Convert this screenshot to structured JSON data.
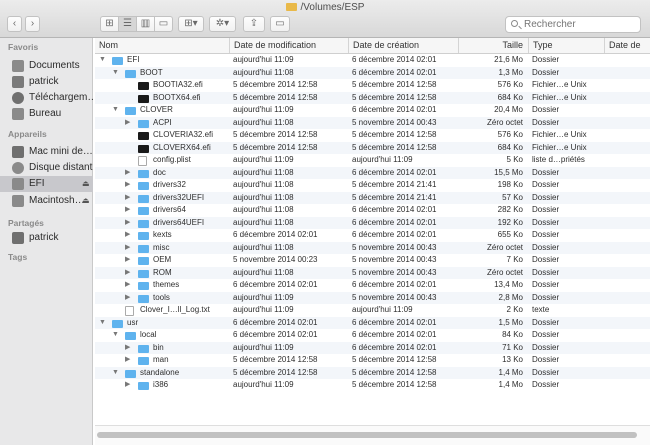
{
  "window": {
    "title": "/Volumes/ESP"
  },
  "toolbar": {
    "back": "‹",
    "forward": "›",
    "views": [
      "⊞",
      "☰",
      "▥",
      "▭"
    ],
    "arrange": "⊞▾",
    "action": "✲▾",
    "share": "⇪",
    "tags": "▭",
    "search_placeholder": "Rechercher"
  },
  "sidebar": {
    "sections": [
      {
        "title": "Favoris",
        "items": [
          {
            "label": "Documents",
            "icon": "documents-icon"
          },
          {
            "label": "patrick",
            "icon": "home-icon"
          },
          {
            "label": "Téléchargem…",
            "icon": "downloads-icon"
          },
          {
            "label": "Bureau",
            "icon": "desktop-icon"
          }
        ]
      },
      {
        "title": "Appareils",
        "items": [
          {
            "label": "Mac mini de…",
            "icon": "computer-icon"
          },
          {
            "label": "Disque distant",
            "icon": "disc-icon"
          },
          {
            "label": "EFI",
            "icon": "drive-icon",
            "eject": "⏏",
            "selected": true
          },
          {
            "label": "Macintosh…",
            "icon": "drive-icon",
            "eject": "⏏"
          }
        ]
      },
      {
        "title": "Partagés",
        "items": [
          {
            "label": "patrick",
            "icon": "network-computer-icon"
          }
        ]
      },
      {
        "title": "Tags",
        "items": []
      }
    ]
  },
  "columns": {
    "name": "Nom",
    "modified": "Date de modification",
    "created": "Date de création",
    "size": "Taille",
    "kind": "Type",
    "added": "Date de"
  },
  "files": [
    {
      "name": "EFI",
      "level": 0,
      "tri": "▼",
      "icon": "folder",
      "modified": "aujourd'hui 11:09",
      "created": "6 décembre 2014 02:01",
      "size": "21,6 Mo",
      "kind": "Dossier"
    },
    {
      "name": "BOOT",
      "level": 1,
      "tri": "▼",
      "icon": "folder",
      "modified": "aujourd'hui 11:08",
      "created": "6 décembre 2014 02:01",
      "size": "1,3 Mo",
      "kind": "Dossier"
    },
    {
      "name": "BOOTIA32.efi",
      "level": 2,
      "tri": "",
      "icon": "exec",
      "modified": "5 décembre 2014 12:58",
      "created": "5 décembre 2014 12:58",
      "size": "576 Ko",
      "kind": "Fichier…e Unix"
    },
    {
      "name": "BOOTX64.efi",
      "level": 2,
      "tri": "",
      "icon": "exec",
      "modified": "5 décembre 2014 12:58",
      "created": "5 décembre 2014 12:58",
      "size": "684 Ko",
      "kind": "Fichier…e Unix"
    },
    {
      "name": "CLOVER",
      "level": 1,
      "tri": "▼",
      "icon": "folder",
      "modified": "aujourd'hui 11:09",
      "created": "6 décembre 2014 02:01",
      "size": "20,4 Mo",
      "kind": "Dossier"
    },
    {
      "name": "ACPI",
      "level": 2,
      "tri": "▶",
      "icon": "folder",
      "modified": "aujourd'hui 11:08",
      "created": "5 novembre 2014 00:43",
      "size": "Zéro octet",
      "kind": "Dossier"
    },
    {
      "name": "CLOVERIA32.efi",
      "level": 2,
      "tri": "",
      "icon": "exec",
      "modified": "5 décembre 2014 12:58",
      "created": "5 décembre 2014 12:58",
      "size": "576 Ko",
      "kind": "Fichier…e Unix"
    },
    {
      "name": "CLOVERX64.efi",
      "level": 2,
      "tri": "",
      "icon": "exec",
      "modified": "5 décembre 2014 12:58",
      "created": "5 décembre 2014 12:58",
      "size": "684 Ko",
      "kind": "Fichier…e Unix"
    },
    {
      "name": "config.plist",
      "level": 2,
      "tri": "",
      "icon": "doc",
      "modified": "aujourd'hui 11:09",
      "created": "aujourd'hui 11:09",
      "size": "5 Ko",
      "kind": "liste d…priétés"
    },
    {
      "name": "doc",
      "level": 2,
      "tri": "▶",
      "icon": "folder",
      "modified": "aujourd'hui 11:08",
      "created": "6 décembre 2014 02:01",
      "size": "15,5 Mo",
      "kind": "Dossier"
    },
    {
      "name": "drivers32",
      "level": 2,
      "tri": "▶",
      "icon": "folder",
      "modified": "aujourd'hui 11:08",
      "created": "5 décembre 2014 21:41",
      "size": "198 Ko",
      "kind": "Dossier"
    },
    {
      "name": "drivers32UEFI",
      "level": 2,
      "tri": "▶",
      "icon": "folder",
      "modified": "aujourd'hui 11:08",
      "created": "5 décembre 2014 21:41",
      "size": "57 Ko",
      "kind": "Dossier"
    },
    {
      "name": "drivers64",
      "level": 2,
      "tri": "▶",
      "icon": "folder",
      "modified": "aujourd'hui 11:08",
      "created": "6 décembre 2014 02:01",
      "size": "282 Ko",
      "kind": "Dossier"
    },
    {
      "name": "drivers64UEFI",
      "level": 2,
      "tri": "▶",
      "icon": "folder",
      "modified": "aujourd'hui 11:08",
      "created": "6 décembre 2014 02:01",
      "size": "192 Ko",
      "kind": "Dossier"
    },
    {
      "name": "kexts",
      "level": 2,
      "tri": "▶",
      "icon": "folder",
      "modified": "6 décembre 2014 02:01",
      "created": "6 décembre 2014 02:01",
      "size": "655 Ko",
      "kind": "Dossier"
    },
    {
      "name": "misc",
      "level": 2,
      "tri": "▶",
      "icon": "folder",
      "modified": "aujourd'hui 11:08",
      "created": "5 novembre 2014 00:43",
      "size": "Zéro octet",
      "kind": "Dossier"
    },
    {
      "name": "OEM",
      "level": 2,
      "tri": "▶",
      "icon": "folder",
      "modified": "5 novembre 2014 00:23",
      "created": "5 novembre 2014 00:43",
      "size": "7 Ko",
      "kind": "Dossier"
    },
    {
      "name": "ROM",
      "level": 2,
      "tri": "▶",
      "icon": "folder",
      "modified": "aujourd'hui 11:08",
      "created": "5 novembre 2014 00:43",
      "size": "Zéro octet",
      "kind": "Dossier"
    },
    {
      "name": "themes",
      "level": 2,
      "tri": "▶",
      "icon": "folder",
      "modified": "6 décembre 2014 02:01",
      "created": "6 décembre 2014 02:01",
      "size": "13,4 Mo",
      "kind": "Dossier"
    },
    {
      "name": "tools",
      "level": 2,
      "tri": "▶",
      "icon": "folder",
      "modified": "aujourd'hui 11:09",
      "created": "5 novembre 2014 00:43",
      "size": "2,8 Mo",
      "kind": "Dossier"
    },
    {
      "name": "Clover_I…ll_Log.txt",
      "level": 1,
      "tri": "",
      "icon": "doc",
      "modified": "aujourd'hui 11:09",
      "created": "aujourd'hui 11:09",
      "size": "2 Ko",
      "kind": "texte"
    },
    {
      "name": "usr",
      "level": 0,
      "tri": "▼",
      "icon": "folder",
      "modified": "6 décembre 2014 02:01",
      "created": "6 décembre 2014 02:01",
      "size": "1,5 Mo",
      "kind": "Dossier"
    },
    {
      "name": "local",
      "level": 1,
      "tri": "▼",
      "icon": "folder",
      "modified": "6 décembre 2014 02:01",
      "created": "6 décembre 2014 02:01",
      "size": "84 Ko",
      "kind": "Dossier"
    },
    {
      "name": "bin",
      "level": 2,
      "tri": "▶",
      "icon": "folder",
      "modified": "aujourd'hui 11:09",
      "created": "6 décembre 2014 02:01",
      "size": "71 Ko",
      "kind": "Dossier"
    },
    {
      "name": "man",
      "level": 2,
      "tri": "▶",
      "icon": "folder",
      "modified": "5 décembre 2014 12:58",
      "created": "5 décembre 2014 12:58",
      "size": "13 Ko",
      "kind": "Dossier"
    },
    {
      "name": "standalone",
      "level": 1,
      "tri": "▼",
      "icon": "folder",
      "modified": "5 décembre 2014 12:58",
      "created": "5 décembre 2014 12:58",
      "size": "1,4 Mo",
      "kind": "Dossier"
    },
    {
      "name": "i386",
      "level": 2,
      "tri": "▶",
      "icon": "folder",
      "modified": "aujourd'hui 11:09",
      "created": "5 décembre 2014 12:58",
      "size": "1,4 Mo",
      "kind": "Dossier"
    }
  ],
  "colors": {
    "folder": "#5fb3ee",
    "selection": "#c8c8cc",
    "row_alt": "#f3f6fa"
  }
}
